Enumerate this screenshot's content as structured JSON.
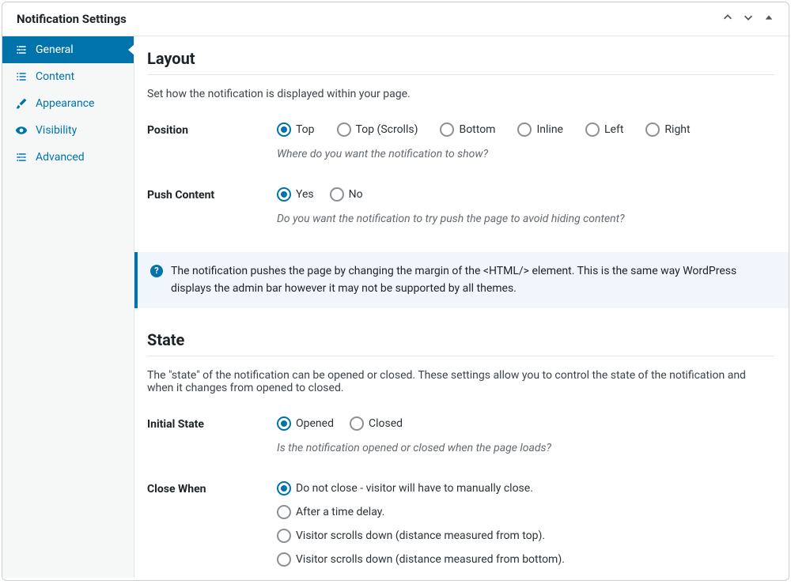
{
  "panel": {
    "title": "Notification Settings"
  },
  "sidebar": {
    "items": [
      {
        "label": "General"
      },
      {
        "label": "Content"
      },
      {
        "label": "Appearance"
      },
      {
        "label": "Visibility"
      },
      {
        "label": "Advanced"
      }
    ]
  },
  "sections": {
    "layout": {
      "title": "Layout",
      "desc": "Set how the notification is displayed within your page."
    },
    "state": {
      "title": "State",
      "desc": "The \"state\" of the notification can be opened or closed. These settings allow you to control the state of the notification and when it changes from opened to closed."
    }
  },
  "fields": {
    "position": {
      "label": "Position",
      "hint": "Where do you want the notification to show?",
      "options": [
        "Top",
        "Top (Scrolls)",
        "Bottom",
        "Inline",
        "Left",
        "Right"
      ]
    },
    "pushContent": {
      "label": "Push Content",
      "hint": "Do you want the notification to try push the page to avoid hiding content?",
      "options": [
        "Yes",
        "No"
      ]
    },
    "initialState": {
      "label": "Initial State",
      "hint": "Is the notification opened or closed when the page loads?",
      "options": [
        "Opened",
        "Closed"
      ]
    },
    "closeWhen": {
      "label": "Close When",
      "options": [
        "Do not close - visitor will have to manually close.",
        "After a time delay.",
        "Visitor scrolls down (distance measured from top).",
        "Visitor scrolls down (distance measured from bottom)."
      ]
    }
  },
  "info": {
    "pushContent": "The notification pushes the page by changing the margin of the <HTML/> element. This is the same way WordPress displays the admin bar however it may not be supported by all themes."
  }
}
